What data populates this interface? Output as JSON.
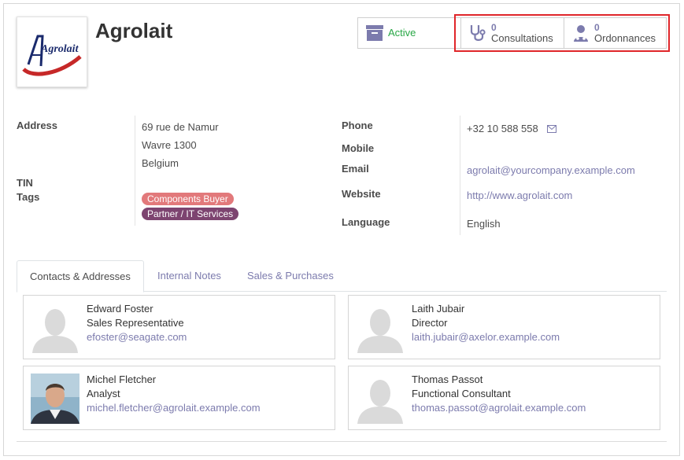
{
  "partner": {
    "name": "Agrolait",
    "logo_text": "Agrolait"
  },
  "smart_buttons": {
    "active": {
      "label": "Active",
      "icon": "archive-icon"
    },
    "consultations": {
      "count": "0",
      "label": "Consultations",
      "icon": "stethoscope-icon"
    },
    "ordonnances": {
      "count": "0",
      "label": "Ordonnances",
      "icon": "user-doctor-icon"
    }
  },
  "fields": {
    "address_label": "Address",
    "address_street": "69 rue de Namur",
    "address_city": "Wavre 1300",
    "address_country": "Belgium",
    "tin_label": "TIN",
    "tags_label": "Tags",
    "tags": [
      "Components Buyer",
      "Partner / IT Services"
    ],
    "phone_label": "Phone",
    "phone_value": "+32 10 588 558",
    "mobile_label": "Mobile",
    "email_label": "Email",
    "email_value": "agrolait@yourcompany.example.com",
    "website_label": "Website",
    "website_value": "http://www.agrolait.com",
    "language_label": "Language",
    "language_value": "English"
  },
  "tabs": [
    "Contacts & Addresses",
    "Internal Notes",
    "Sales & Purchases"
  ],
  "active_tab": "Contacts & Addresses",
  "contacts": [
    {
      "name": "Edward Foster",
      "function": "Sales Representative",
      "email": "efoster@seagate.com",
      "photo": "placeholder"
    },
    {
      "name": "Laith Jubair",
      "function": "Director",
      "email": "laith.jubair@axelor.example.com",
      "photo": "placeholder"
    },
    {
      "name": "Michel Fletcher",
      "function": "Analyst",
      "email": "michel.fletcher@agrolait.example.com",
      "photo": "portrait"
    },
    {
      "name": "Thomas Passot",
      "function": "Functional Consultant",
      "email": "thomas.passot@agrolait.example.com",
      "photo": "placeholder"
    }
  ],
  "colors": {
    "link": "#7c7bad",
    "active_green": "#28a745",
    "highlight_red": "#e0262a",
    "tag_components": "#e2797b",
    "tag_partner": "#7d4470"
  }
}
